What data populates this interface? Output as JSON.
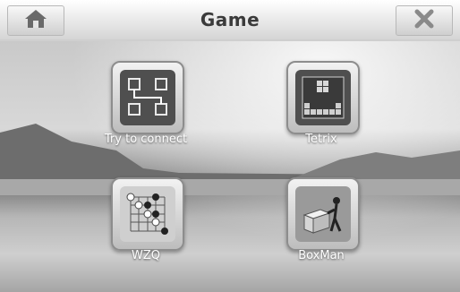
{
  "header": {
    "title": "Game",
    "home_icon": "home-icon",
    "close_icon": "close-icon"
  },
  "apps": [
    {
      "label": "Try to connect",
      "icon": "connect-icon"
    },
    {
      "label": "Tetrix",
      "icon": "tetrix-icon"
    },
    {
      "label": "WZQ",
      "icon": "wzq-icon"
    },
    {
      "label": "BoxMan",
      "icon": "boxman-icon"
    }
  ],
  "colors": {
    "header_top": "#ffffff",
    "header_bottom": "#d5d5d5",
    "icon_frame": "#8d8d8d",
    "label": "#ffffff"
  }
}
